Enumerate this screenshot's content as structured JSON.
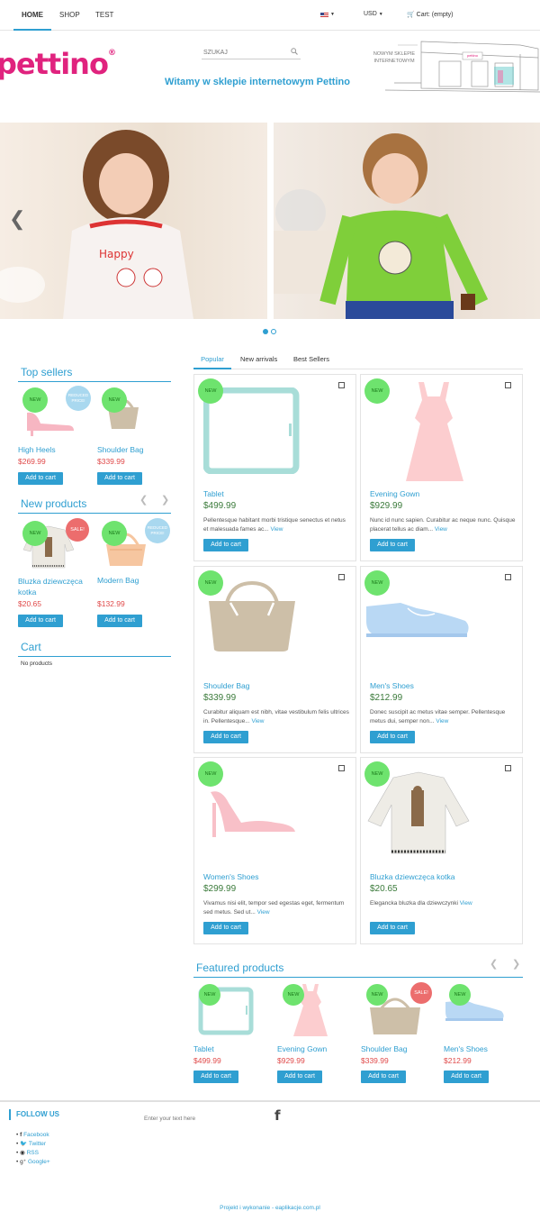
{
  "nav": {
    "items": [
      "HOME",
      "SHOP",
      "TEST"
    ],
    "currency": "USD",
    "cart": "Cart: (empty)"
  },
  "header": {
    "logo": "pettino",
    "logo_mark": "®",
    "search_placeholder": "SZUKAJ",
    "welcome": "Witamy w sklepie internetowym Pettino",
    "store_sign": "NOWYM SKLEPIE INTERNETOWYM",
    "store_shop_label": "pettino"
  },
  "tabs": [
    "Popular",
    "New arrivals",
    "Best Sellers"
  ],
  "sidebar": {
    "top_sellers": {
      "title": "Top sellers",
      "items": [
        {
          "name": "High Heels",
          "price": "$269.99",
          "badge": "NEW",
          "badge2": "REDUCED PRICE!"
        },
        {
          "name": "Shoulder Bag",
          "price": "$339.99",
          "badge": "NEW"
        }
      ]
    },
    "new_products": {
      "title": "New products",
      "items": [
        {
          "name": "Bluzka dziewczęca kotka",
          "price": "$20.65",
          "badge": "NEW",
          "badge2": "SALE!"
        },
        {
          "name": "Modern Bag",
          "price": "$132.99",
          "badge": "NEW",
          "badge2": "REDUCED PRICE!"
        }
      ]
    },
    "cart": {
      "title": "Cart",
      "empty": "No products"
    },
    "add_to_cart": "Add to cart"
  },
  "products": [
    {
      "name": "Tablet",
      "price": "$499.99",
      "desc": "Pellentesque habitant morbi tristique senectus et netus et malesuada fames ac...",
      "badge": "NEW"
    },
    {
      "name": "Evening Gown",
      "price": "$929.99",
      "desc": "Nunc id nunc sapien. Curabitur ac neque nunc. Quisque placerat tellus ac diam...",
      "badge": "NEW"
    },
    {
      "name": "Shoulder Bag",
      "price": "$339.99",
      "desc": "Curabitur aliquam est nibh, vitae vestibulum felis ultrices in. Pellentesque...",
      "badge": "NEW"
    },
    {
      "name": "Men's Shoes",
      "price": "$212.99",
      "desc": "Donec suscipit ac metus vitae semper. Pellentesque metus dui, semper non...",
      "badge": "NEW"
    },
    {
      "name": "Women's Shoes",
      "price": "$299.99",
      "desc": "Vivamus nisi elit, tempor sed egestas eget, fermentum sed metus. Sed ut...",
      "badge": "NEW"
    },
    {
      "name": "Bluzka dziewczęca kotka",
      "price": "$20.65",
      "desc": "Elegancka bluzka dla dziewczynki",
      "badge": "NEW"
    }
  ],
  "view_label": "View",
  "featured": {
    "title": "Featured products",
    "items": [
      {
        "name": "Tablet",
        "price": "$499.99",
        "badge": "NEW"
      },
      {
        "name": "Evening Gown",
        "price": "$929.99",
        "badge": "NEW"
      },
      {
        "name": "Shoulder Bag",
        "price": "$339.99",
        "badge": "NEW",
        "badge2": "SALE!"
      },
      {
        "name": "Men's Shoes",
        "price": "$212.99",
        "badge": "NEW"
      }
    ]
  },
  "footer": {
    "follow_title": "FOLLOW US",
    "links": [
      "Facebook",
      "Twitter",
      "RSS",
      "Google+"
    ],
    "newsletter_placeholder": "Enter your text here",
    "credit": "Projekt i wykonanie - eaplikacje.com.pl"
  },
  "colors": {
    "accent": "#2f9fd1",
    "price_red": "#e04a4a",
    "badge_green": "#6ee36e",
    "logo_pink": "#e0237e"
  }
}
